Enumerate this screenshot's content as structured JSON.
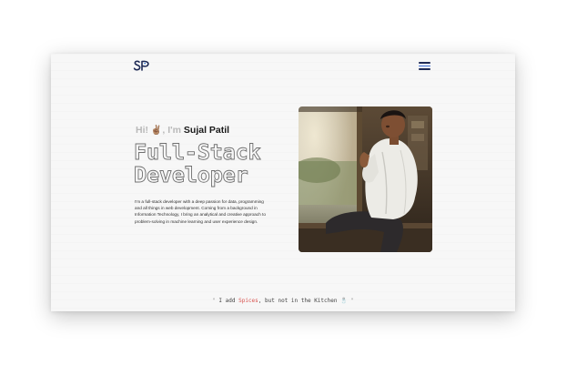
{
  "header": {
    "logo_text": "SP",
    "menu_icon": "hamburger-menu-icon"
  },
  "hero": {
    "greeting_prefix": "Hi!",
    "greeting_emoji": "✌🏽",
    "greeting_mid": "I'm",
    "name": "Sujal Patil",
    "title_line1": "Full-Stack",
    "title_line2": "Developer",
    "intro": "I'm a full-stack developer with a deep passion for data, programming and all things in web development. Coming from a background in Information Technology, I bring an analytical and creative approach to problem-solving in machine learning and user experience design."
  },
  "footer_quote": {
    "open_mark": "\"",
    "text_before": "I add",
    "highlight": "Spices",
    "text_after": ", but not in the Kitchen",
    "emoji": "🧂",
    "close_mark": "\""
  },
  "colors": {
    "page_bg": "#f7f7f7",
    "accent_navy": "#1e2a55",
    "highlight_red": "#d9534f",
    "muted_gray": "#b9b9b9"
  }
}
